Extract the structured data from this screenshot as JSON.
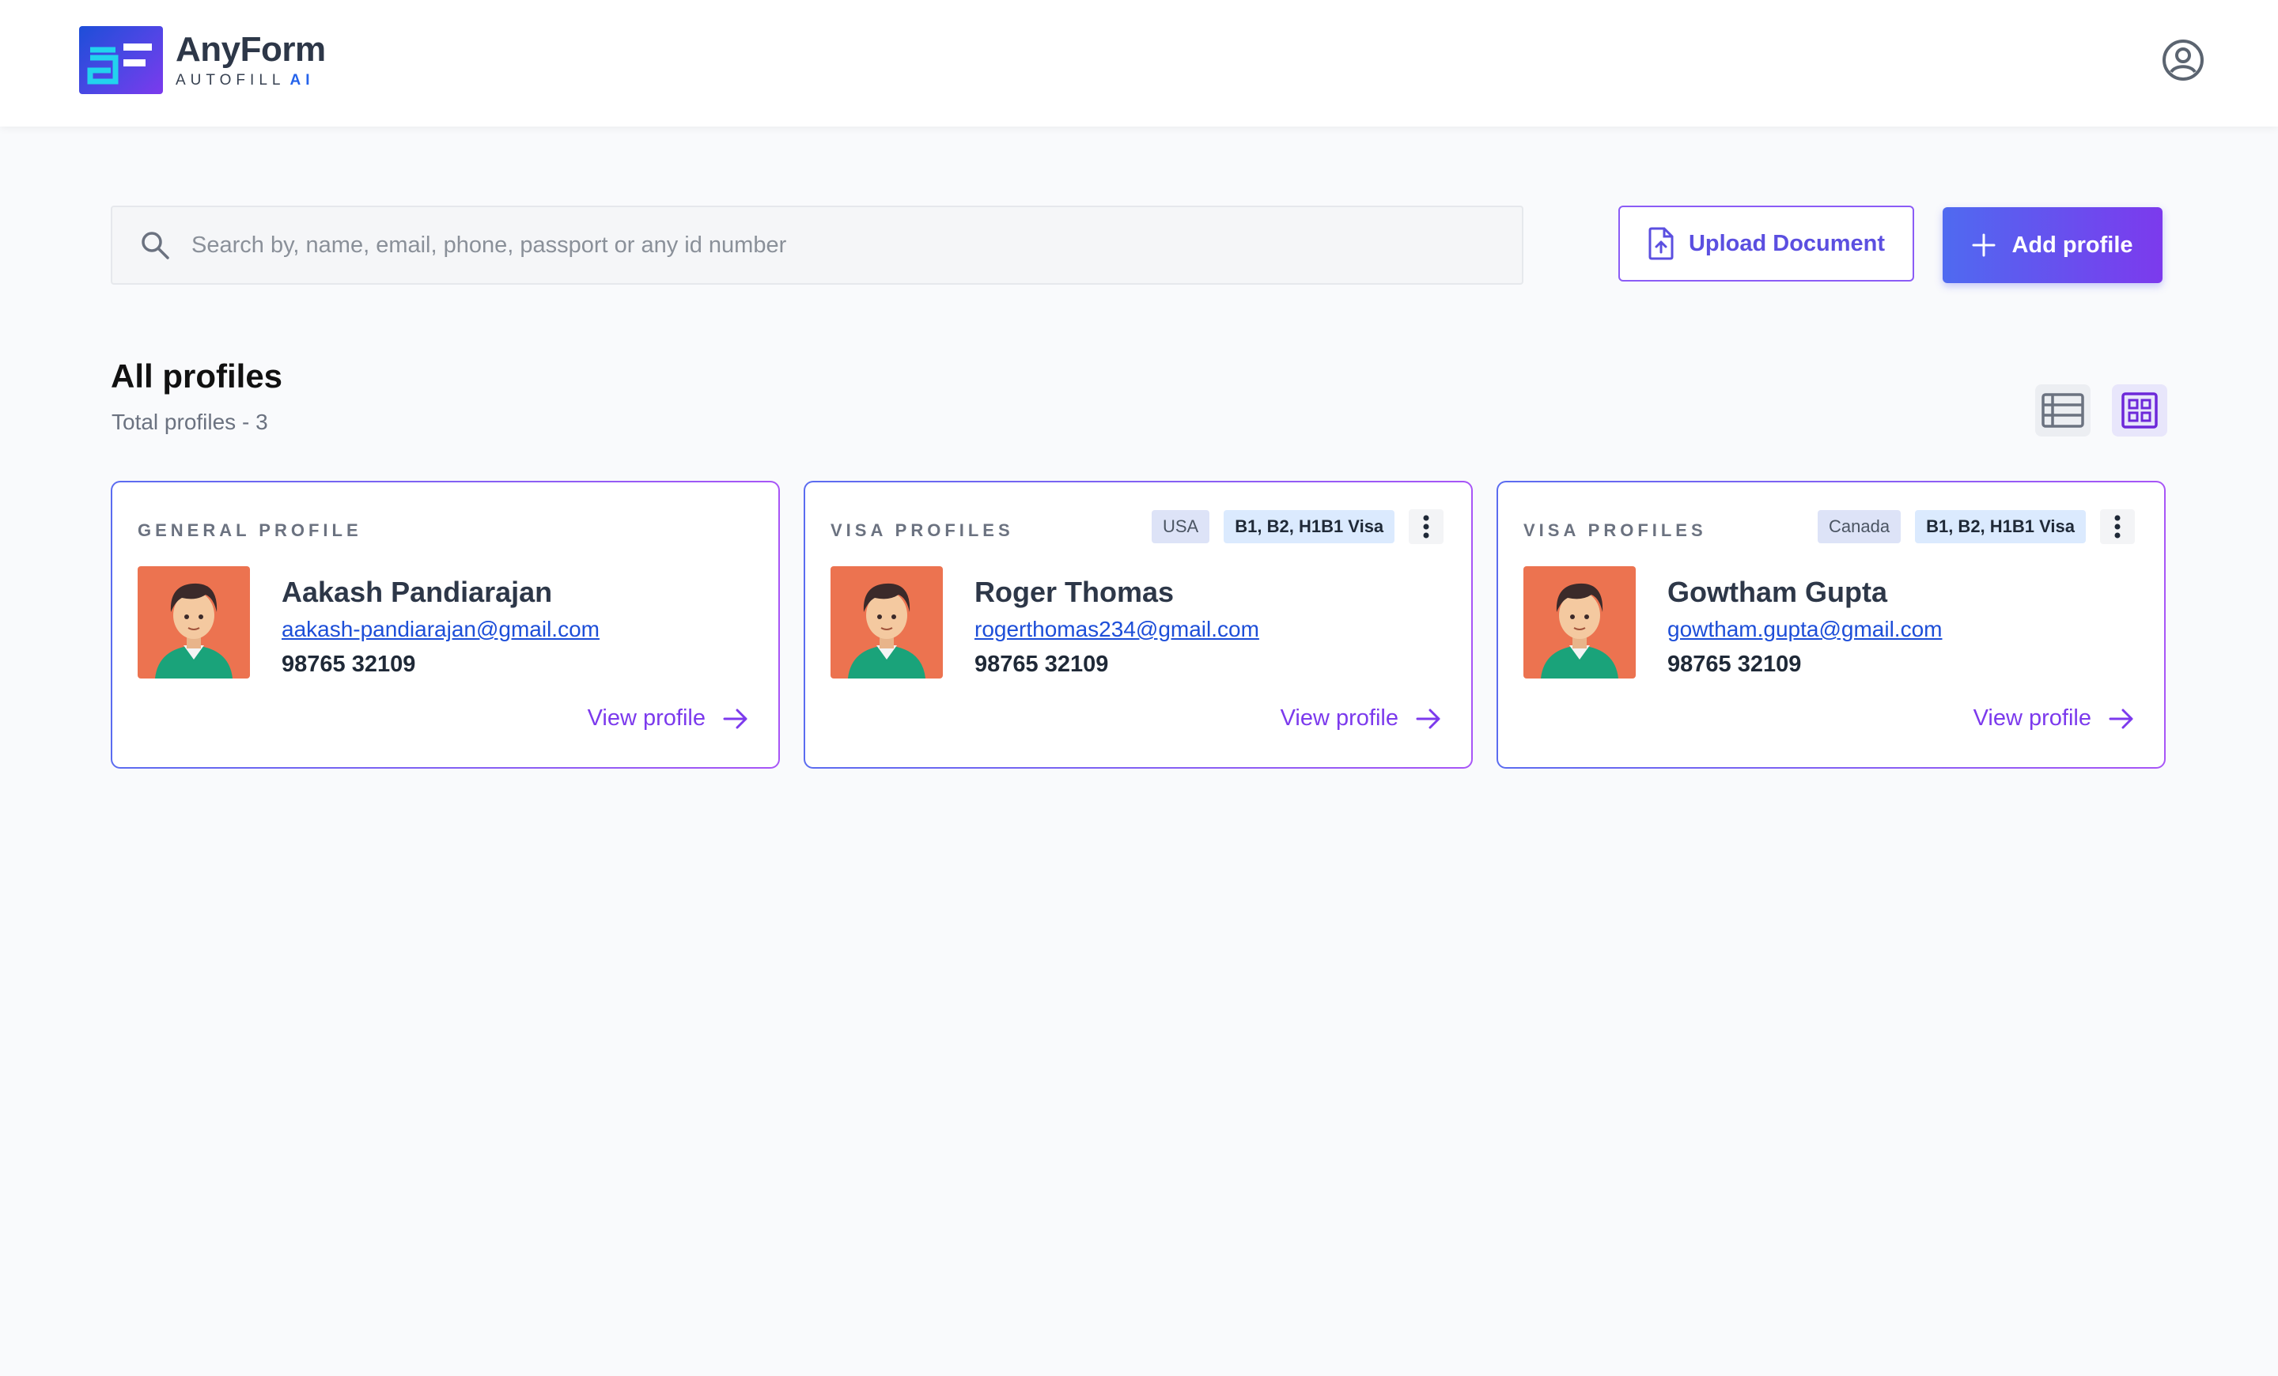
{
  "app": {
    "name": "AnyForm",
    "sub": "AUTOFILL",
    "sub_ai": "AI"
  },
  "search": {
    "placeholder": "Search by, name, email, phone, passport or any id number"
  },
  "actions": {
    "upload_label": "Upload Document",
    "add_label": "Add profile"
  },
  "section": {
    "title": "All profiles",
    "total": "Total profiles - 3"
  },
  "colors": {
    "accent": "#7c3aed",
    "primary_blue": "#4f6af0",
    "avatar_bg": "#ec7350",
    "link": "#1d4ed8"
  },
  "profiles": [
    {
      "type": "GENERAL PROFILE",
      "name": "Aakash Pandiarajan",
      "email": "aakash-pandiarajan@gmail.com",
      "phone": "98765 32109",
      "view_label": "View profile"
    },
    {
      "type": "VISA PROFILES",
      "country": "USA",
      "visa": "B1, B2, H1B1 Visa",
      "name": "Roger Thomas",
      "email": "rogerthomas234@gmail.com",
      "phone": "98765 32109",
      "view_label": "View profile"
    },
    {
      "type": "VISA PROFILES",
      "country": "Canada",
      "visa": "B1, B2, H1B1 Visa",
      "name": "Gowtham Gupta",
      "email": "gowtham.gupta@gmail.com",
      "phone": "98765 32109",
      "view_label": "View profile"
    }
  ]
}
